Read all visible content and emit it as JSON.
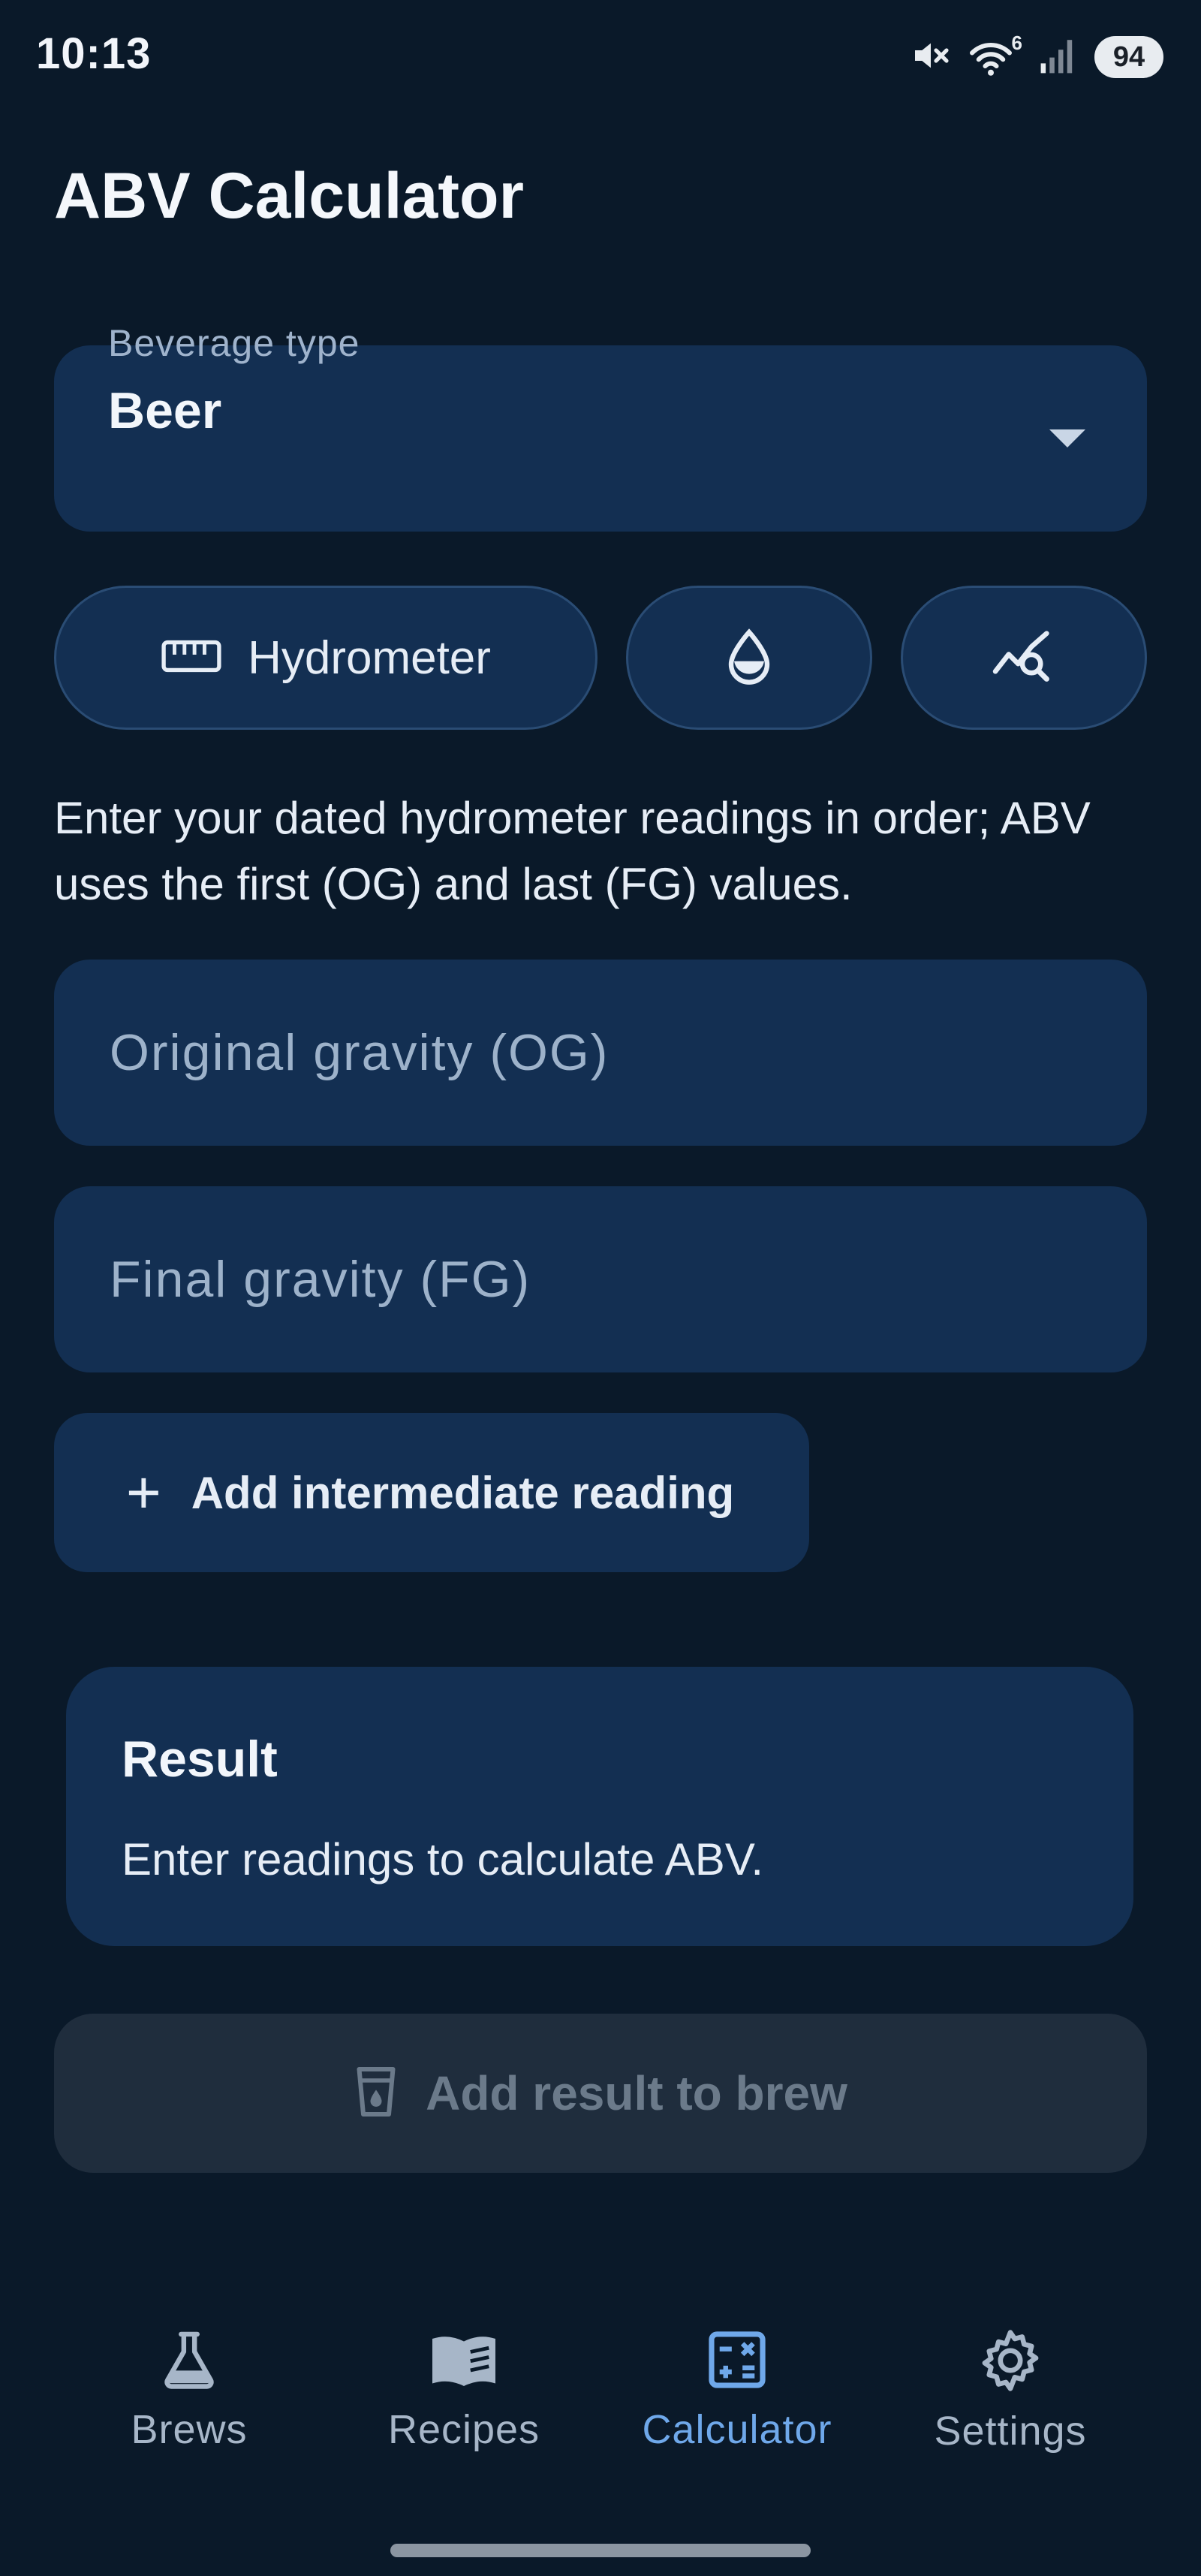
{
  "status_bar": {
    "time": "10:13",
    "wifi_badge": "6",
    "battery": "94"
  },
  "page": {
    "title": "ABV Calculator"
  },
  "beverage": {
    "label": "Beverage type",
    "value": "Beer"
  },
  "modes": {
    "hydrometer_label": "Hydrometer",
    "selected": "Hydrometer"
  },
  "helper_text": "Enter your dated hydrometer readings in order; ABV uses the first (OG) and last (FG) values.",
  "fields": {
    "og_placeholder": "Original gravity (OG)",
    "fg_placeholder": "Final gravity (FG)"
  },
  "add_reading": {
    "icon": "+",
    "label": "Add intermediate reading"
  },
  "result": {
    "title": "Result",
    "text": "Enter readings to calculate ABV."
  },
  "add_to_brew": {
    "label": "Add result to brew",
    "enabled": false
  },
  "nav": {
    "items": [
      {
        "label": "Brews",
        "icon": "flask-icon"
      },
      {
        "label": "Recipes",
        "icon": "book-icon"
      },
      {
        "label": "Calculator",
        "icon": "calculator-icon",
        "active": true
      },
      {
        "label": "Settings",
        "icon": "gear-icon"
      }
    ]
  },
  "colors": {
    "background": "#0a1929",
    "surface": "#132f52",
    "accent": "#6fa8ea",
    "disabled_surface": "#1f2d3d"
  }
}
